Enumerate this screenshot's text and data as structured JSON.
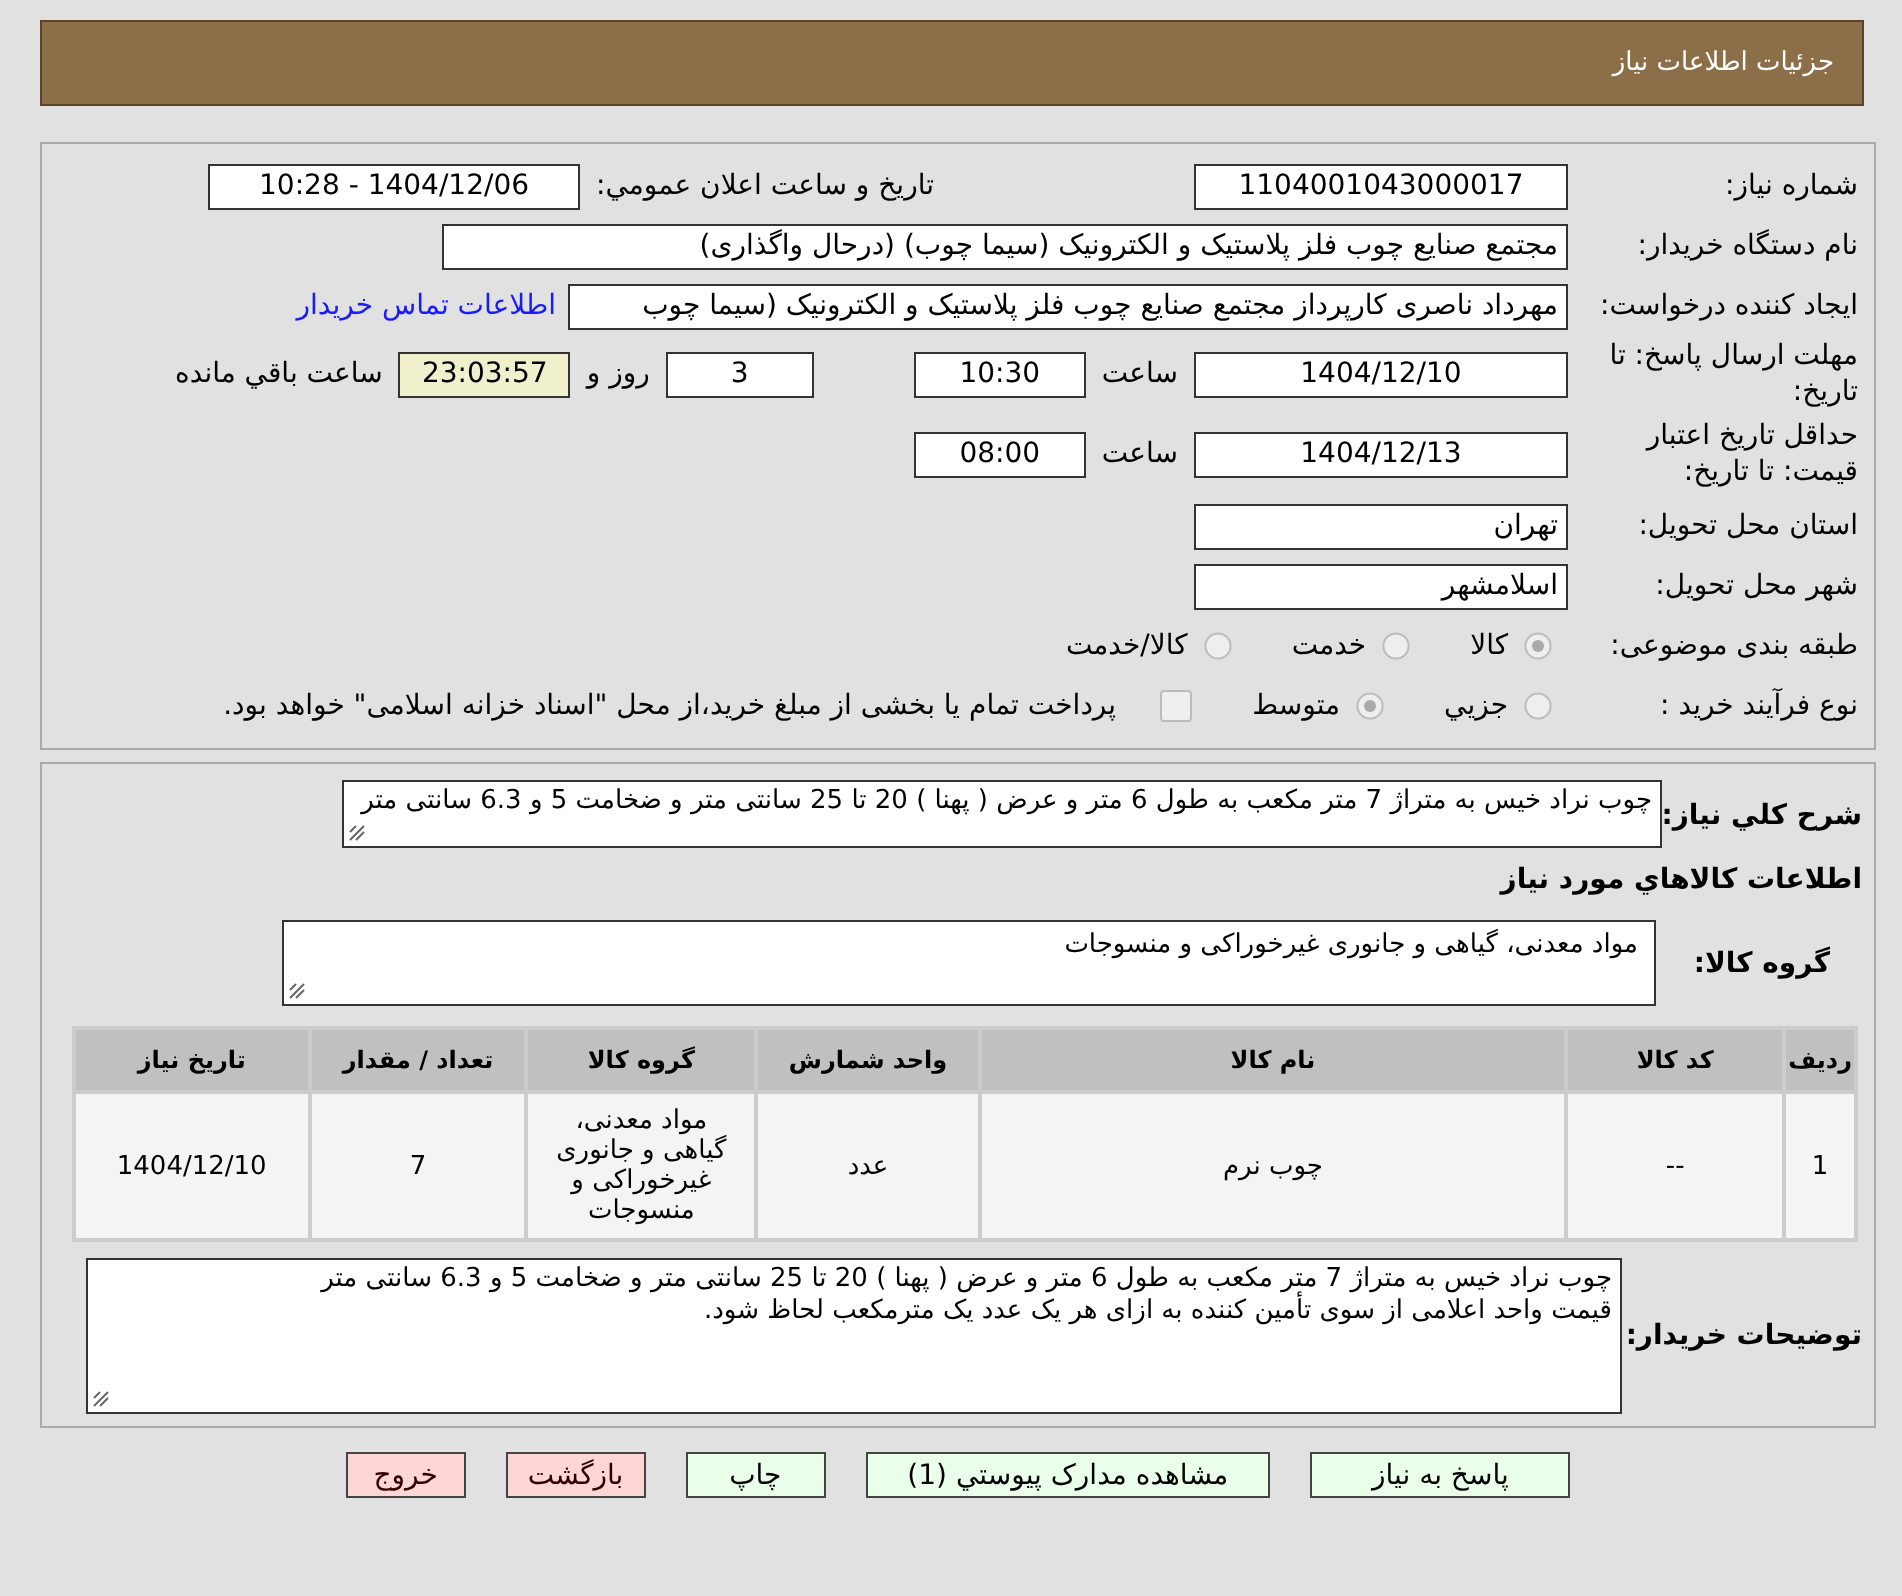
{
  "header": {
    "title": "جزئیات اطلاعات نیاز"
  },
  "details": {
    "need_number": {
      "label": "شماره نیاز:",
      "value": "1104001043000017"
    },
    "announce": {
      "label": "تاریخ و ساعت اعلان عمومي:",
      "value": "1404/12/06 - 10:28"
    },
    "buyer": {
      "label": "نام دستگاه خریدار:",
      "value": "مجتمع  صنایع چوب  فلز  پلاستیک و الکترونیک (سیما چوب) (درحال واگذاری)"
    },
    "creator": {
      "label": "ایجاد کننده درخواست:",
      "value": "مهرداد ناصری کارپرداز مجتمع  صنایع چوب  فلز  پلاستیک و الکترونیک (سیما چوب",
      "link": "اطلاعات تماس خریدار"
    },
    "deadline": {
      "label": "مهلت ارسال پاسخ: تا تاریخ:",
      "date": "1404/12/10",
      "time_label": "ساعت",
      "time": "10:30",
      "days": "3",
      "days_label": "روز و",
      "remaining": "23:03:57",
      "remaining_label": "ساعت باقي مانده"
    },
    "validity": {
      "label": "حداقل تاریخ اعتبار قیمت: تا تاریخ:",
      "date": "1404/12/13",
      "time_label": "ساعت",
      "time": "08:00"
    },
    "province": {
      "label": "استان محل تحویل:",
      "value": "تهران"
    },
    "city": {
      "label": "شهر محل تحویل:",
      "value": "اسلامشهر"
    },
    "category": {
      "label": "طبقه بندی موضوعی:",
      "options": [
        {
          "label": "کالا",
          "selected": true
        },
        {
          "label": "خدمت",
          "selected": false
        },
        {
          "label": "کالا/خدمت",
          "selected": false
        }
      ]
    },
    "process": {
      "label": "نوع فرآیند خرید :",
      "options": [
        {
          "label": "جزيي",
          "selected": false
        },
        {
          "label": "متوسط",
          "selected": true
        }
      ],
      "payment": {
        "label": "پرداخت تمام یا بخشی از مبلغ خرید،از محل \"اسناد خزانه اسلامی\" خواهد بود.",
        "checked": false
      }
    }
  },
  "description": {
    "label": "شرح کلي نیاز:",
    "value": "چوب نراد خیس به متراژ 7 متر مکعب به طول 6 متر و عرض ( پهنا ) 20 تا 25 سانتی متر و ضخامت 5 و 6.3 سانتی متر"
  },
  "goods_heading": "اطلاعات کالاهاي مورد نیاز",
  "goods_group": {
    "label": "گروه کالا:",
    "value": "مواد معدنی، گیاهی و جانوری غیرخوراکی و منسوجات"
  },
  "table": {
    "columns": [
      "ردیف",
      "کد کالا",
      "نام کالا",
      "واحد شمارش",
      "گروه کالا",
      "تعداد / مقدار",
      "تاریخ نیاز"
    ],
    "rows": [
      [
        "1",
        "--",
        "چوب نرم",
        "عدد",
        "مواد معدنی، گیاهی و جانوری غیرخوراکی و منسوجات",
        "7",
        "1404/12/10"
      ]
    ]
  },
  "buyer_notes": {
    "label": "توضیحات خریدار:",
    "value": "چوب نراد خیس به متراژ 7 متر مکعب به طول 6 متر و عرض ( پهنا ) 20 تا 25 سانتی متر و ضخامت 5 و 6.3 سانتی متر\nقیمت واحد اعلامی از سوی تأمین کننده به ازای هر یک عدد یک مترمکعب لحاظ شود."
  },
  "buttons": [
    {
      "label": "پاسخ به نیاز",
      "kind": "go"
    },
    {
      "label": "مشاهده مدارک پیوستي (1)",
      "kind": "go"
    },
    {
      "label": "چاپ",
      "kind": "go"
    },
    {
      "label": "بازگشت",
      "kind": "stop"
    },
    {
      "label": "خروج",
      "kind": "stop"
    }
  ]
}
